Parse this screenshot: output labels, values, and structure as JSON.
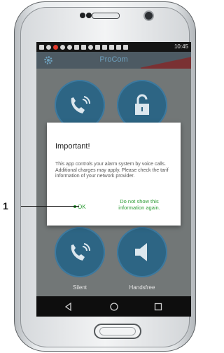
{
  "callout": {
    "number": "1"
  },
  "statusbar": {
    "time": "10:45"
  },
  "app": {
    "title": "ProCom"
  },
  "buttons": [
    {
      "label": "",
      "icon": "phone-alarm-icon"
    },
    {
      "label": "",
      "icon": "unlock-icon"
    },
    {
      "label": "Silent",
      "icon": "phone-silent-icon"
    },
    {
      "label": "Handsfree",
      "icon": "speaker-icon"
    }
  ],
  "dialog": {
    "title": "Important!",
    "body": "This app controls your alarm system by voice calls. Additional charges may apply. Please check the tarif information of your network provider.",
    "ok_label": "OK",
    "dont_show_label": "Do not show this information again."
  },
  "navbar": {
    "back": "back-icon",
    "home": "home-icon",
    "recents": "recents-icon"
  },
  "colors": {
    "accent": "#2a9a32",
    "button": "#2d6584",
    "toolbar": "#4d5a63"
  }
}
